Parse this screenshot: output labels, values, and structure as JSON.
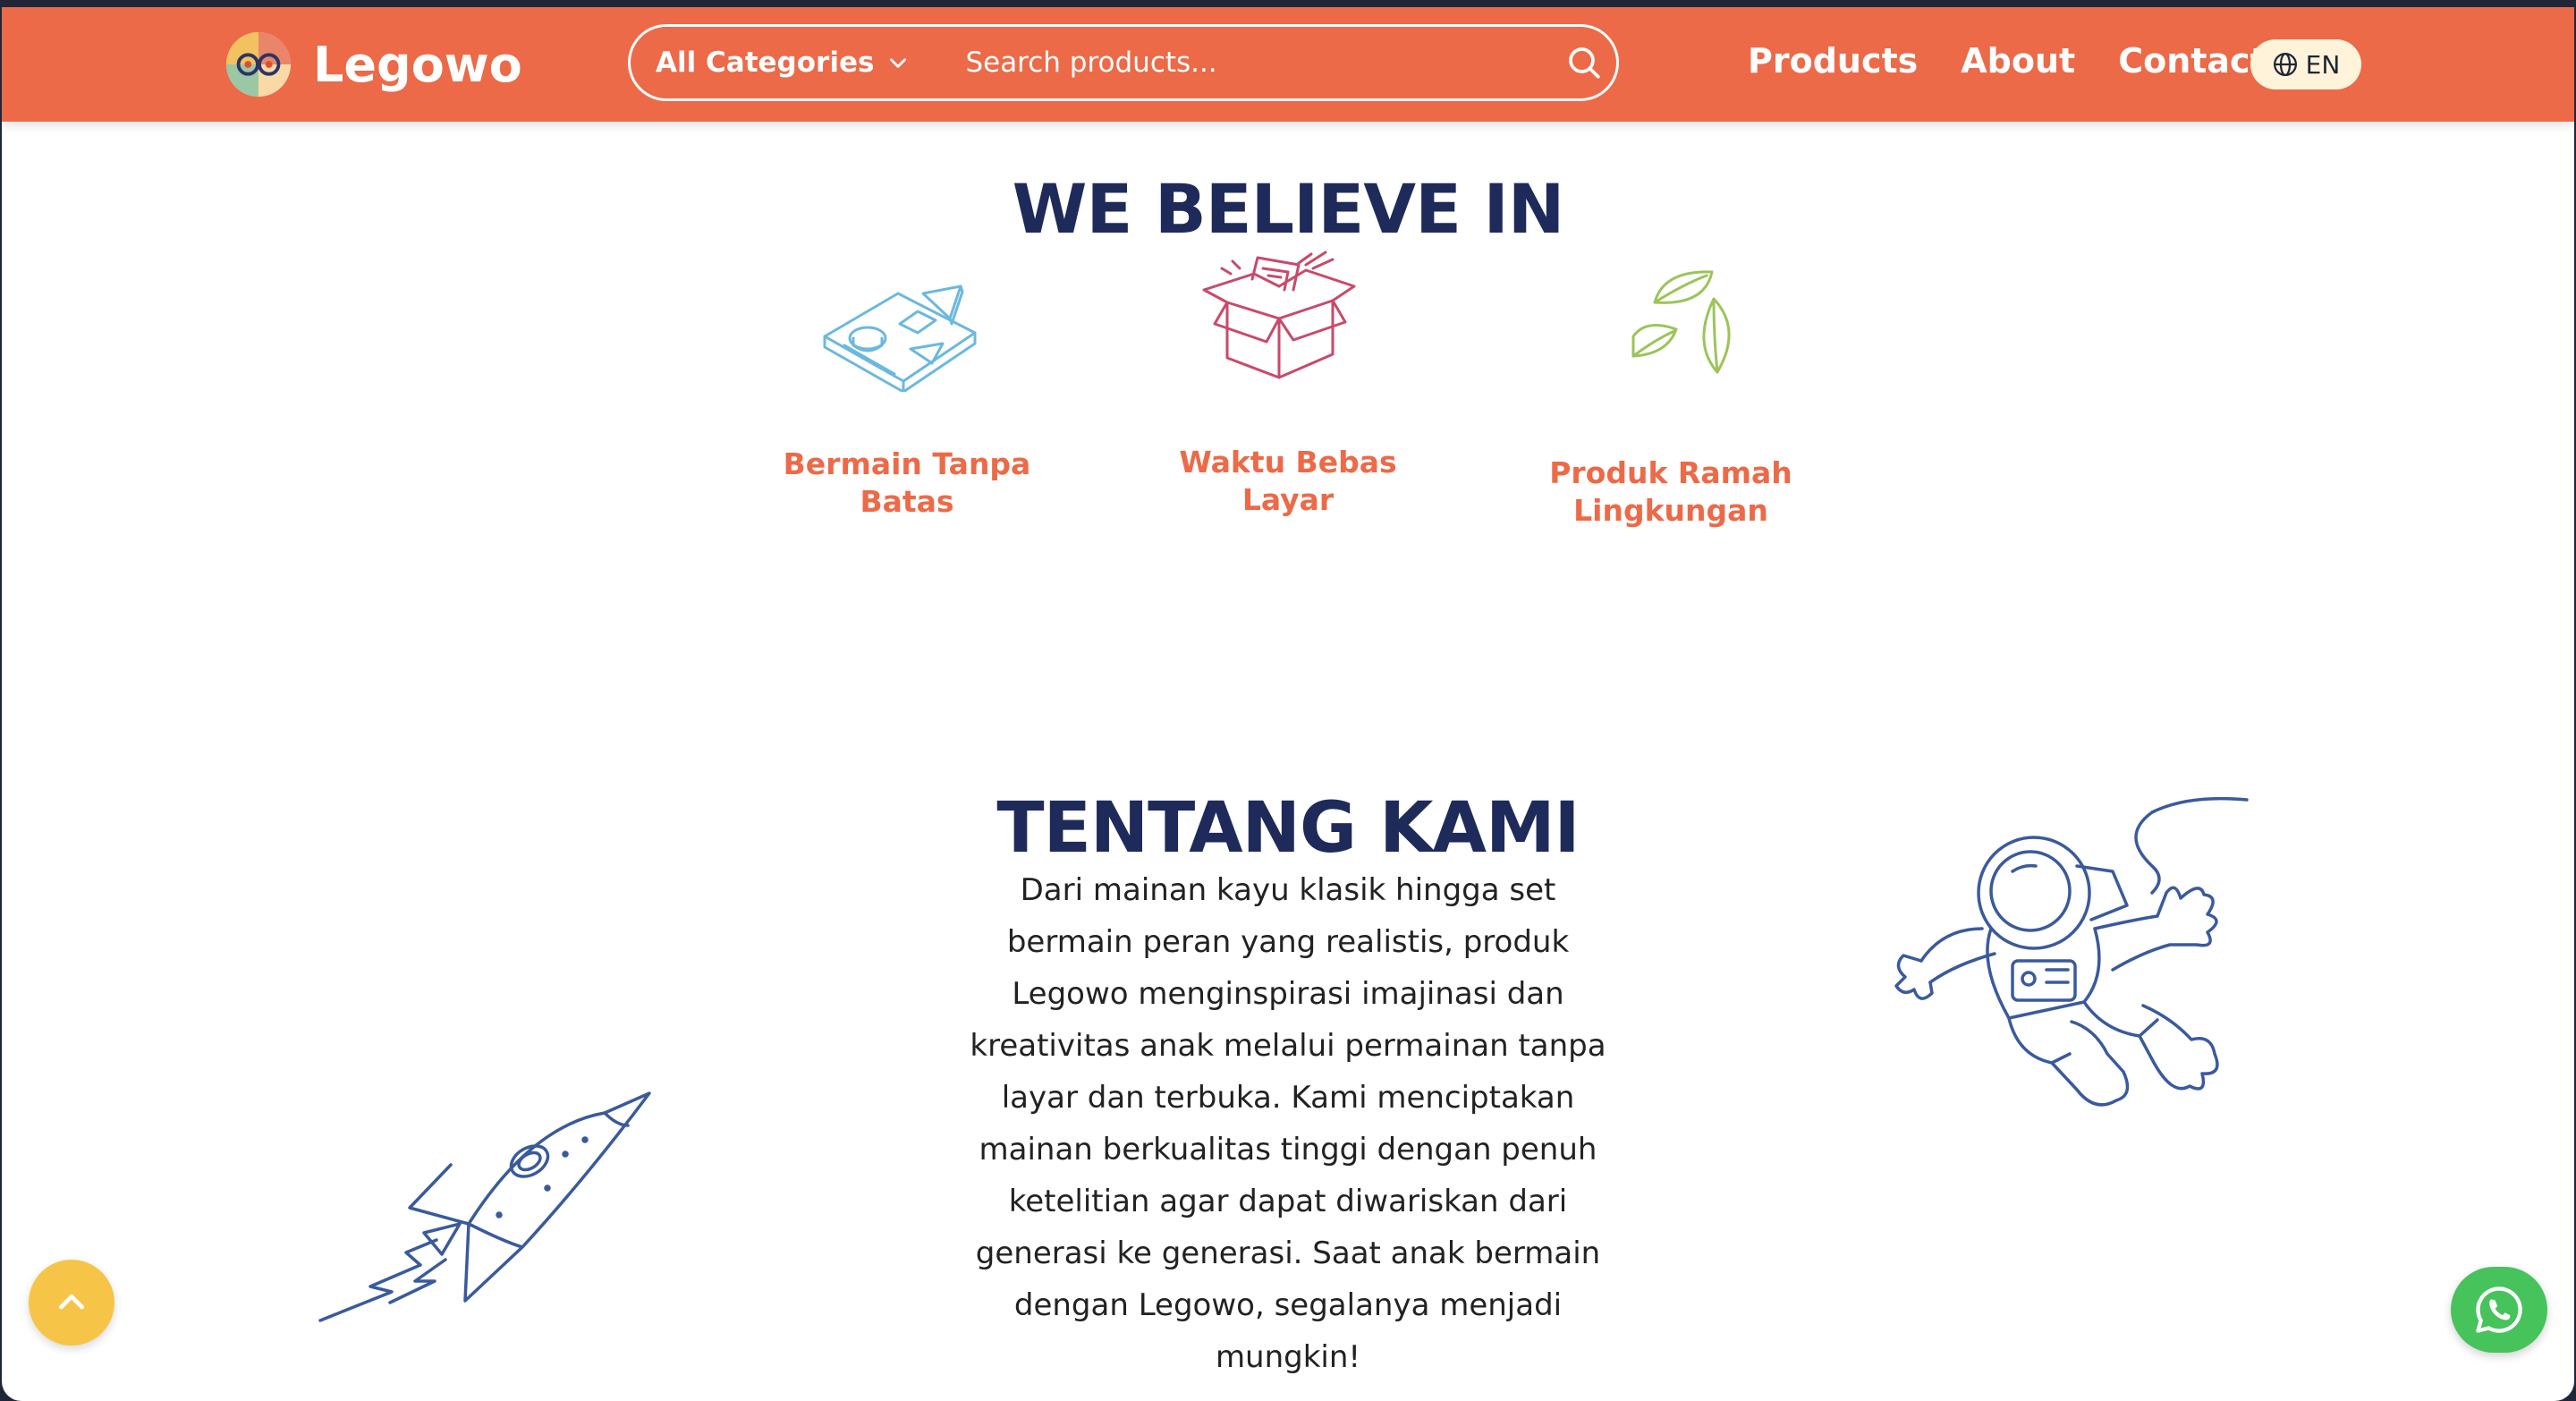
{
  "brand": {
    "name": "Legowo",
    "logo_icon": "legowo-logo-icon"
  },
  "search": {
    "category_label": "All Categories",
    "placeholder": "Search products...",
    "value": ""
  },
  "nav": {
    "products": "Products",
    "about": "About",
    "contact": "Contact",
    "language": "EN"
  },
  "values_section": {
    "title": "WE BELIEVE IN",
    "items": [
      {
        "label": "Bermain Tanpa Batas",
        "icon": "shape-sorter-icon",
        "color": "#6cb8de"
      },
      {
        "label": "Waktu Bebas Layar",
        "icon": "open-box-icon",
        "color": "#c84a6a"
      },
      {
        "label": "Produk Ramah Lingkungan",
        "icon": "leaves-icon",
        "color": "#9cc45a"
      }
    ]
  },
  "about_section": {
    "title": "TENTANG KAMI",
    "body": "Dari mainan kayu klasik hingga set bermain peran yang realistis, produk Legowo menginspirasi imajinasi dan kreativitas anak melalui permainan tanpa layar dan terbuka. Kami menciptakan mainan berkualitas tinggi dengan penuh ketelitian agar dapat diwariskan dari generasi ke generasi. Saat anak bermain dengan Legowo, segalanya menjadi mungkin!"
  },
  "colors": {
    "primary": "#ec6a48",
    "heading": "#1e2a5a",
    "illustration": "#3a5a9c",
    "scroll_top": "#f6c548",
    "whatsapp": "#46c35b"
  },
  "floating": {
    "scroll_top_icon": "chevron-up-icon",
    "whatsapp_icon": "whatsapp-icon"
  }
}
